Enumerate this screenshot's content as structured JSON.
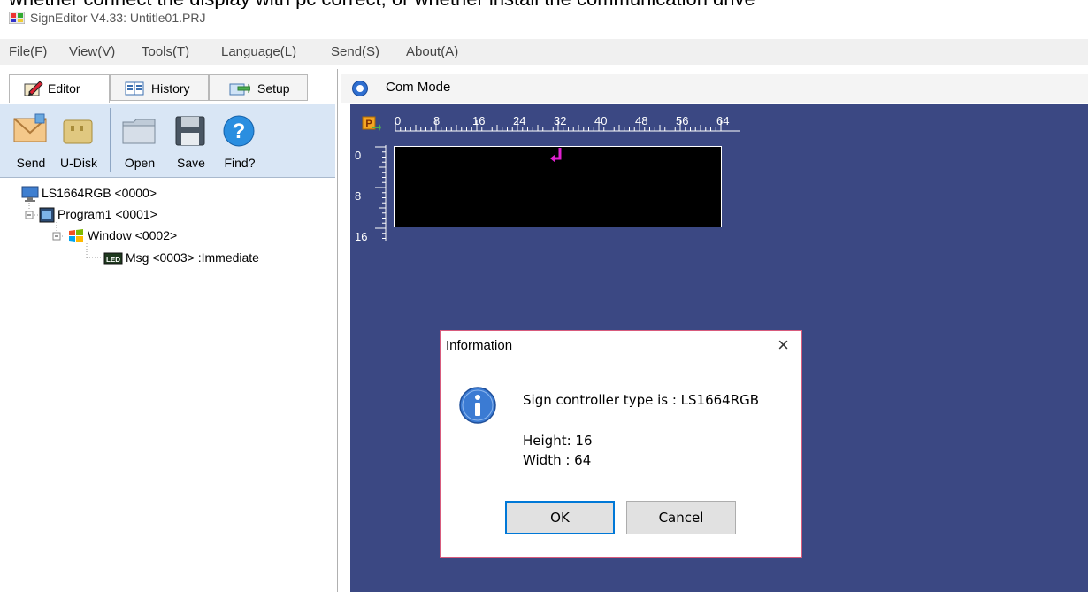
{
  "overlay_caption": "whether connect the display with pc correct, or whether install the communication drive",
  "window": {
    "title": "SignEditor V4.33: Untitle01.PRJ"
  },
  "menu": [
    "File(F)",
    "View(V)",
    "Tools(T)",
    "Language(L)",
    "Send(S)",
    "About(A)"
  ],
  "tabs": [
    {
      "label": "Editor",
      "icon": "editor-icon",
      "active": true
    },
    {
      "label": "History",
      "icon": "history-icon",
      "active": false
    },
    {
      "label": "Setup",
      "icon": "setup-icon",
      "active": false
    }
  ],
  "toolbar": [
    {
      "label": "Send",
      "icon": "send-envelope-icon"
    },
    {
      "label": "U-Disk",
      "icon": "usb-disk-icon"
    },
    {
      "label": "Open",
      "icon": "folder-icon"
    },
    {
      "label": "Save",
      "icon": "floppy-disk-icon"
    },
    {
      "label": "Find?",
      "icon": "help-icon"
    }
  ],
  "tree": [
    {
      "label": "LS1664RGB <0000>",
      "icon": "monitor-icon",
      "level": 0
    },
    {
      "label": "Program1 <0001>",
      "icon": "film-icon",
      "level": 1
    },
    {
      "label": "Window <0002>",
      "icon": "window-icon",
      "level": 2
    },
    {
      "label": "Msg <0003> :Immediate",
      "icon": "led-icon",
      "level": 3
    }
  ],
  "com": {
    "label": "Com Mode",
    "icon": "info-round-icon"
  },
  "ruler": {
    "h_ticks": [
      "0",
      "8",
      "16",
      "24",
      "32",
      "40",
      "48",
      "56",
      "64"
    ],
    "v_ticks": [
      "0",
      "8",
      "16"
    ]
  },
  "dialog": {
    "title": "Information",
    "close": "×",
    "message": "Sign controller type is : LS1664RGB",
    "height_line": "Height: 16",
    "width_line": "Width : 64",
    "ok": "OK",
    "cancel": "Cancel"
  },
  "colors": {
    "canvas": "#3b4883",
    "toolbar": "#d9e6f5",
    "dialog_border": "#d85b7d",
    "accent": "#0078d7",
    "cursor": "#e020d0"
  }
}
